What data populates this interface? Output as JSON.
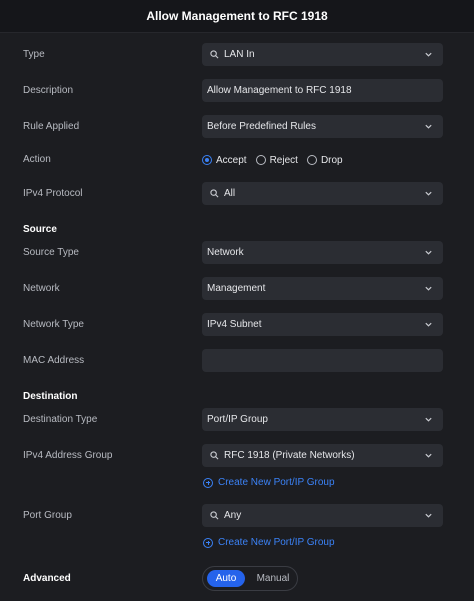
{
  "header": {
    "title": "Allow Management to RFC 1918"
  },
  "fields": {
    "type": {
      "label": "Type",
      "value": "LAN In"
    },
    "description": {
      "label": "Description",
      "value": "Allow Management to RFC 1918"
    },
    "rule_applied": {
      "label": "Rule Applied",
      "value": "Before Predefined Rules"
    },
    "action": {
      "label": "Action",
      "options": [
        "Accept",
        "Reject",
        "Drop"
      ],
      "selected": "Accept"
    },
    "ipv4_protocol": {
      "label": "IPv4 Protocol",
      "value": "All"
    }
  },
  "source": {
    "title": "Source",
    "source_type": {
      "label": "Source Type",
      "value": "Network"
    },
    "network": {
      "label": "Network",
      "value": "Management"
    },
    "network_type": {
      "label": "Network Type",
      "value": "IPv4 Subnet"
    },
    "mac_address": {
      "label": "MAC Address",
      "value": ""
    }
  },
  "destination": {
    "title": "Destination",
    "destination_type": {
      "label": "Destination Type",
      "value": "Port/IP Group"
    },
    "ipv4_address_group": {
      "label": "IPv4 Address Group",
      "value": "RFC 1918 (Private Networks)"
    },
    "create_link_1": "Create New Port/IP Group",
    "port_group": {
      "label": "Port Group",
      "value": "Any"
    },
    "create_link_2": "Create New Port/IP Group"
  },
  "advanced": {
    "label": "Advanced",
    "options": [
      "Auto",
      "Manual"
    ],
    "selected": "Auto"
  },
  "colors": {
    "accent": "#3b82f6",
    "background": "#1c1d21",
    "field_bg": "#2b2d33"
  },
  "icons": {
    "search": "search-icon",
    "chevron": "chevron-down-icon",
    "add": "add-circle-icon"
  }
}
